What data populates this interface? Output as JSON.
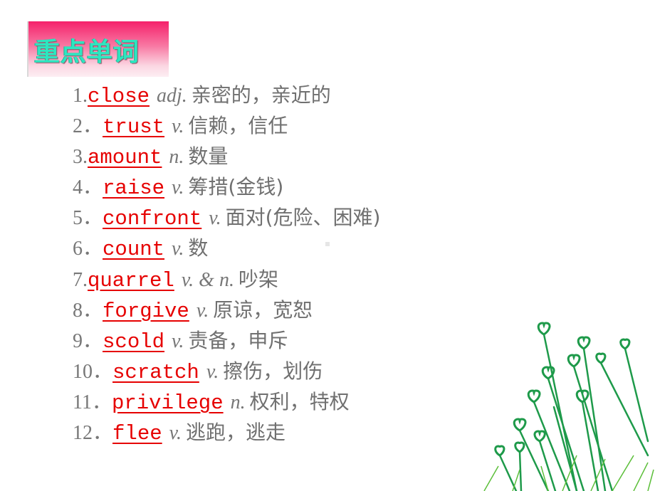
{
  "title": "重点单词",
  "items": [
    {
      "num": "1.",
      "word": "close",
      "pos": "adj.",
      "def": "亲密的，亲近的"
    },
    {
      "num": "2．",
      "word": "trust",
      "pos": "v.",
      "def": "信赖，信任"
    },
    {
      "num": "3.",
      "word": "amount",
      "pos": "n.",
      "def": "数量"
    },
    {
      "num": "4．",
      "word": "raise",
      "pos": "v.",
      "def": "筹措(金钱)"
    },
    {
      "num": "5．",
      "word": "confront",
      "pos": "v.",
      "def": "面对(危险、困难)"
    },
    {
      "num": "6．",
      "word": "count",
      "pos": "v.",
      "def": "数"
    },
    {
      "num": "7.",
      "word": "quarrel",
      "pos": "v. & n.",
      "def": "吵架"
    },
    {
      "num": "8．",
      "word": "forgive",
      "pos": "v.",
      "def": "原谅，宽恕"
    },
    {
      "num": "9．",
      "word": "scold",
      "pos": "v.",
      "def": "责备，申斥"
    },
    {
      "num": "10．",
      "word": "scratch",
      "pos": "v.",
      "def": "擦伤，划伤"
    },
    {
      "num": "11．",
      "word": "privilege",
      "pos": "n.",
      "def": "权利，特权"
    },
    {
      "num": "12．",
      "word": "flee",
      "pos": "v.",
      "def": "逃跑，逃走"
    }
  ],
  "colors": {
    "word": "#e60000",
    "title_text": "#2de6c0",
    "title_bg": "#f5206a",
    "decoration": "#1e9a4a"
  }
}
